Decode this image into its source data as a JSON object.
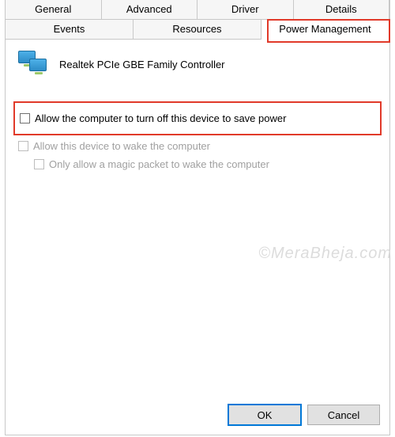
{
  "tabs": {
    "row1": [
      "General",
      "Advanced",
      "Driver",
      "Details"
    ],
    "row2": [
      "Events",
      "Resources",
      "Power Management"
    ],
    "active": "Power Management"
  },
  "device": {
    "name": "Realtek PCIe GBE Family Controller"
  },
  "options": {
    "allow_off": {
      "label": "Allow the computer to turn off this device to save power",
      "checked": false,
      "enabled": true
    },
    "allow_wake": {
      "label": "Allow this device to wake the computer",
      "checked": false,
      "enabled": false
    },
    "magic_packet": {
      "label": "Only allow a magic packet to wake the computer",
      "checked": false,
      "enabled": false
    }
  },
  "buttons": {
    "ok": "OK",
    "cancel": "Cancel"
  },
  "watermark": "©MeraBheja.com"
}
